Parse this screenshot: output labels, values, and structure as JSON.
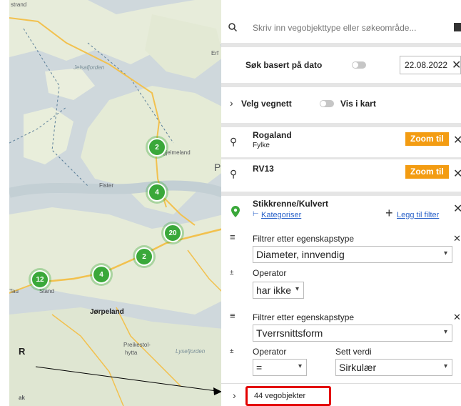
{
  "search": {
    "placeholder": "Skriv inn vegobjekttype eller søkeområde...",
    "icon": "search-icon"
  },
  "date_filter": {
    "label": "Søk basert på dato",
    "value": "22.08.2022"
  },
  "road_network": {
    "label": "Velg vegnett",
    "toggle_label": "Vis i kart"
  },
  "areas": [
    {
      "name": "Rogaland",
      "type": "Fylke",
      "zoom_label": "Zoom til"
    },
    {
      "name": "RV13",
      "type": "",
      "zoom_label": "Zoom til"
    }
  ],
  "object_type": {
    "name": "Stikkrenne/Kulvert",
    "categorize_label": "Kategoriser",
    "add_filter_label": "Legg til filter",
    "filters": [
      {
        "heading": "Filtrer etter egenskapstype",
        "property": "Diameter, innvendig",
        "operator_label": "Operator",
        "operator": "har ikke",
        "value_label": "",
        "value": ""
      },
      {
        "heading": "Filtrer etter egenskapstype",
        "property": "Tverrsnittsform",
        "operator_label": "Operator",
        "operator": "=",
        "value_label": "Sett verdi",
        "value": "Sirkulær"
      }
    ]
  },
  "results": {
    "label": "44 vegobjekter"
  },
  "map": {
    "labels": {
      "top_left": "strand",
      "fjord1": "Jelsafjorden",
      "place1": "gjelmeland",
      "place2": "Fister",
      "place3": "Tau",
      "place4": "Stand",
      "city": "Jørpeland",
      "place5": "Preikestol-",
      "place5b": "hytta",
      "fjord2": "Lysefjorden",
      "edge1": "Erf",
      "edge2": "P",
      "edge3": "R",
      "edge4": "ak"
    },
    "clusters": [
      "2",
      "4",
      "20",
      "2",
      "4",
      "12"
    ]
  },
  "colors": {
    "accent": "#f39c12",
    "cluster": "#3aa83a",
    "highlight": "#e30000",
    "link": "#2a62c9"
  }
}
